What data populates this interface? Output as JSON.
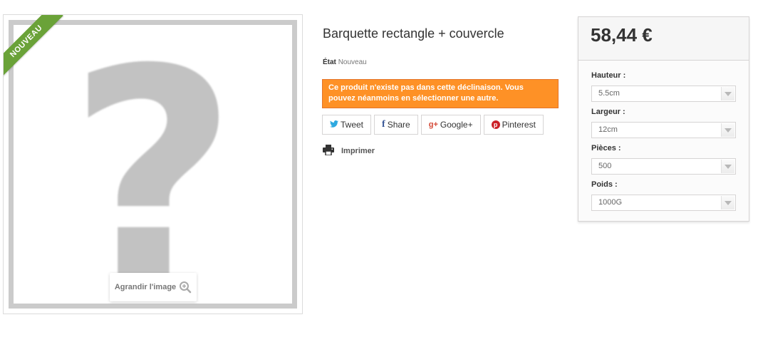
{
  "image": {
    "badge": "Nouveau",
    "placeholder_glyph": "?",
    "zoom_label": "Agrandir l'image"
  },
  "product": {
    "title": "Barquette rectangle + couvercle",
    "condition_label": "État",
    "condition_value": "Nouveau",
    "alert": "Ce produit n'existe pas dans cette déclinaison. Vous pouvez néanmoins en sélectionner une autre.",
    "social": [
      {
        "icon": "twitter-icon",
        "glyph": "🐦",
        "label": "Tweet"
      },
      {
        "icon": "facebook-icon",
        "glyph": "f",
        "label": "Share"
      },
      {
        "icon": "google-plus-icon",
        "glyph": "g+",
        "label": "Google+"
      },
      {
        "icon": "pinterest-icon",
        "glyph": "p",
        "label": "Pinterest"
      }
    ],
    "print_label": "Imprimer"
  },
  "box": {
    "price": "58,44 €",
    "attributes": [
      {
        "label": "Hauteur :",
        "value": "5.5cm"
      },
      {
        "label": "Largeur :",
        "value": "12cm"
      },
      {
        "label": "Pièces :",
        "value": "500"
      },
      {
        "label": "Poids :",
        "value": "1000G"
      }
    ]
  },
  "colors": {
    "badge": "#6aa238",
    "alert": "#fe9126",
    "twitter": "#2ea9e0",
    "facebook": "#3b5998",
    "google": "#d34836",
    "pinterest": "#cb2027"
  }
}
